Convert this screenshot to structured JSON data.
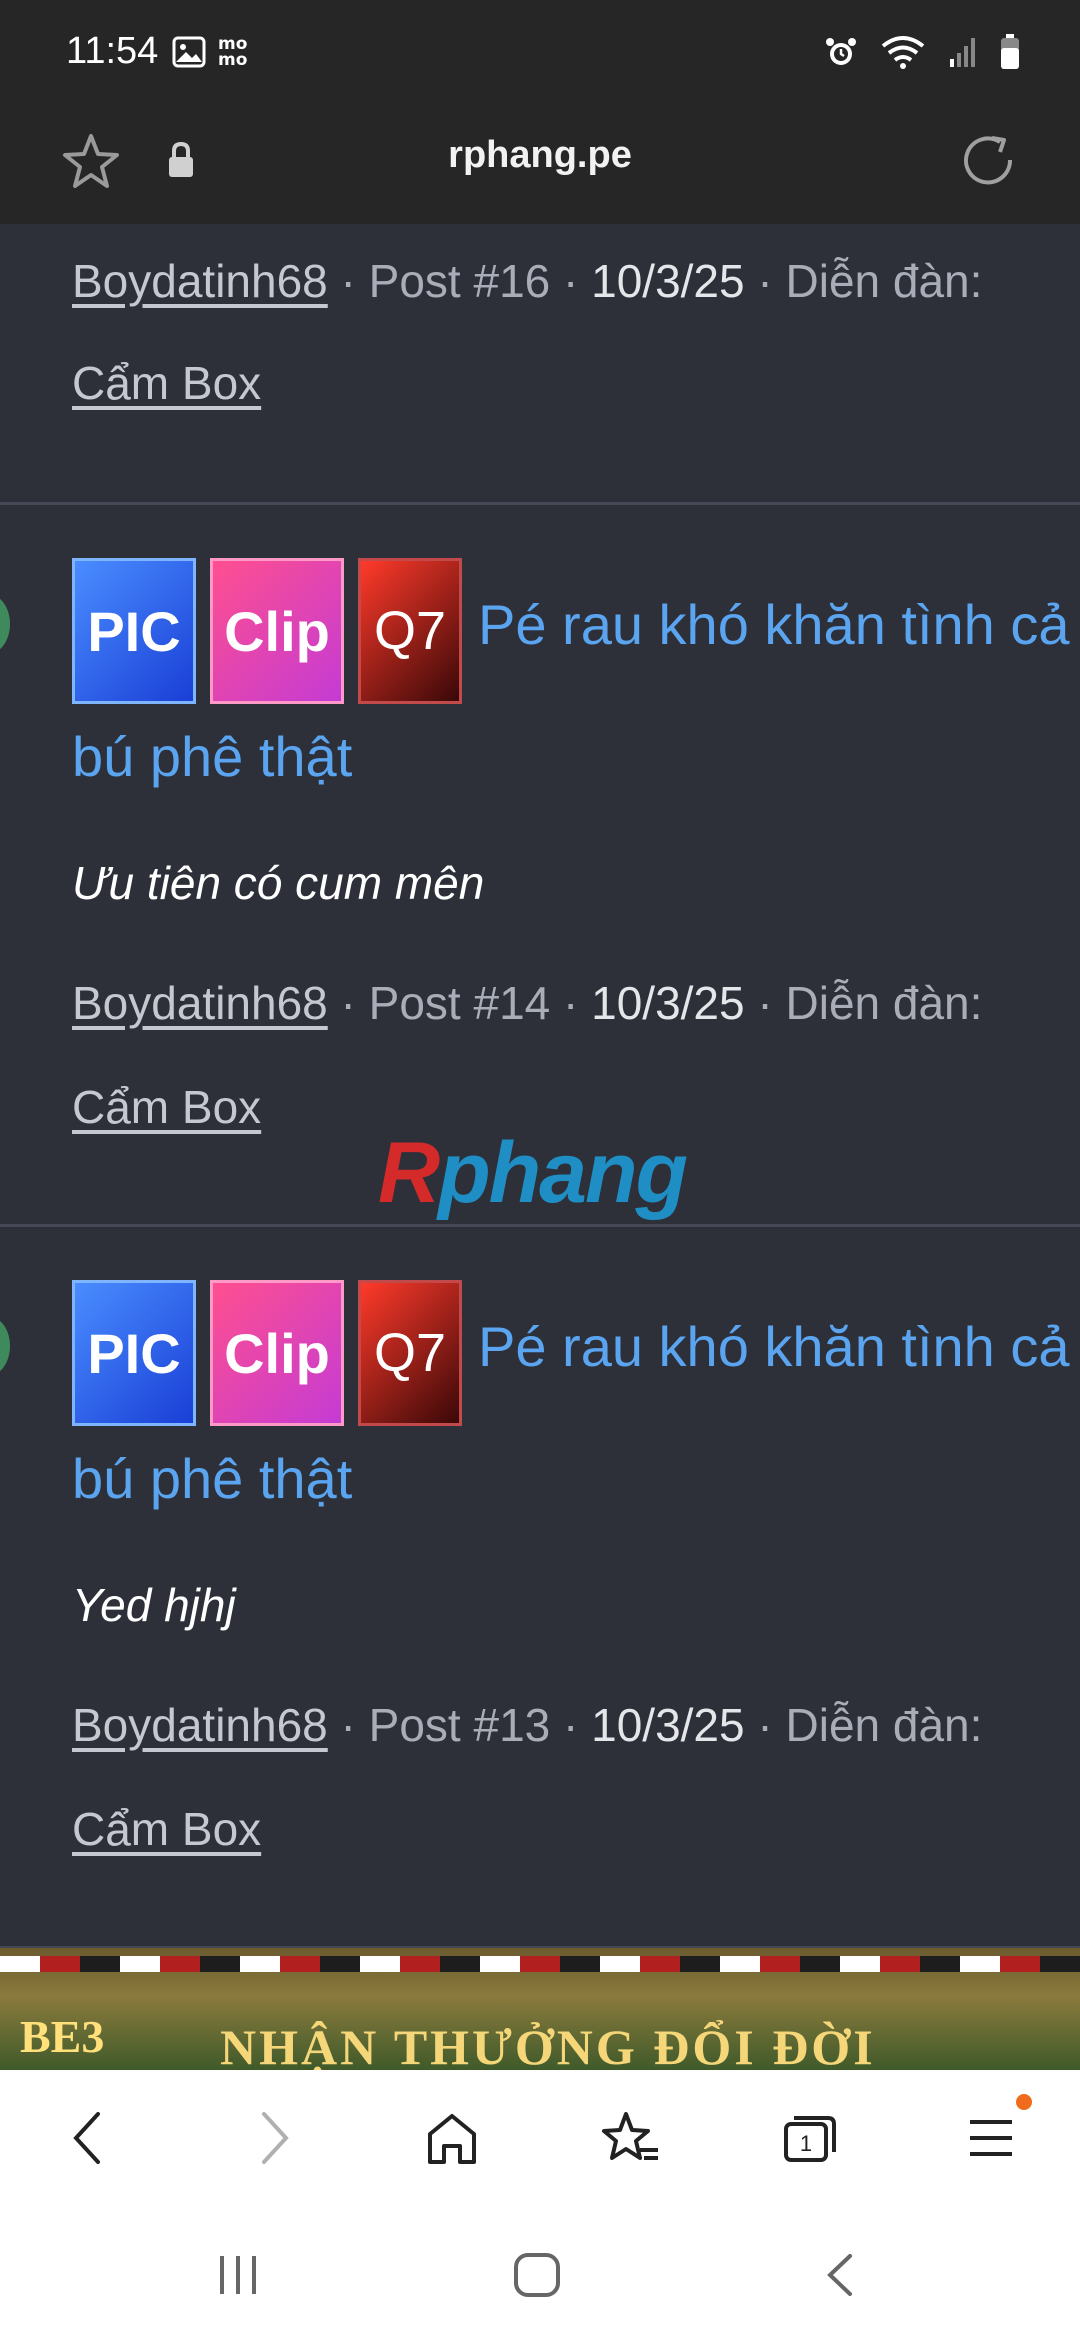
{
  "status_bar": {
    "time": "11:54",
    "icons": [
      "gallery-icon",
      "momo-icon",
      "alarm-icon",
      "wifi-icon",
      "signal-icon",
      "battery-icon"
    ],
    "momo_label": "mo mo"
  },
  "browser": {
    "url": "rphang.pe"
  },
  "posts": [
    {
      "user": "Boydatinh68",
      "post": "Post #16",
      "date": "10/3/25",
      "forum_label": "Diễn đàn:",
      "forum": "Cẩm Box"
    },
    {
      "tags": [
        "PIC",
        "Clip",
        "Q7"
      ],
      "title_line1": "Pé rau khó khăn tình cả",
      "title_line2": "bú phê thật",
      "snippet": "Ưu tiên có cum mên",
      "user": "Boydatinh68",
      "post": "Post #14",
      "date": "10/3/25",
      "forum_label": "Diễn đàn:",
      "forum": "Cẩm Box"
    },
    {
      "tags": [
        "PIC",
        "Clip",
        "Q7"
      ],
      "title_line1": "Pé rau khó khăn tình cả",
      "title_line2": "bú phê thật",
      "snippet": "Yed hjhj",
      "user": "Boydatinh68",
      "post": "Post #13",
      "date": "10/3/25",
      "forum_label": "Diễn đàn:",
      "forum": "Cẩm Box"
    }
  ],
  "watermark": {
    "first": "R",
    "rest": "phang"
  },
  "banner": {
    "left_text": "BE3",
    "text": "NHẬN THƯỞNG ĐỔI ĐỜI"
  },
  "colors": {
    "background": "#2d3039",
    "link_blue": "#5aa4f0",
    "toolbar_dot": "#f06b1b"
  }
}
